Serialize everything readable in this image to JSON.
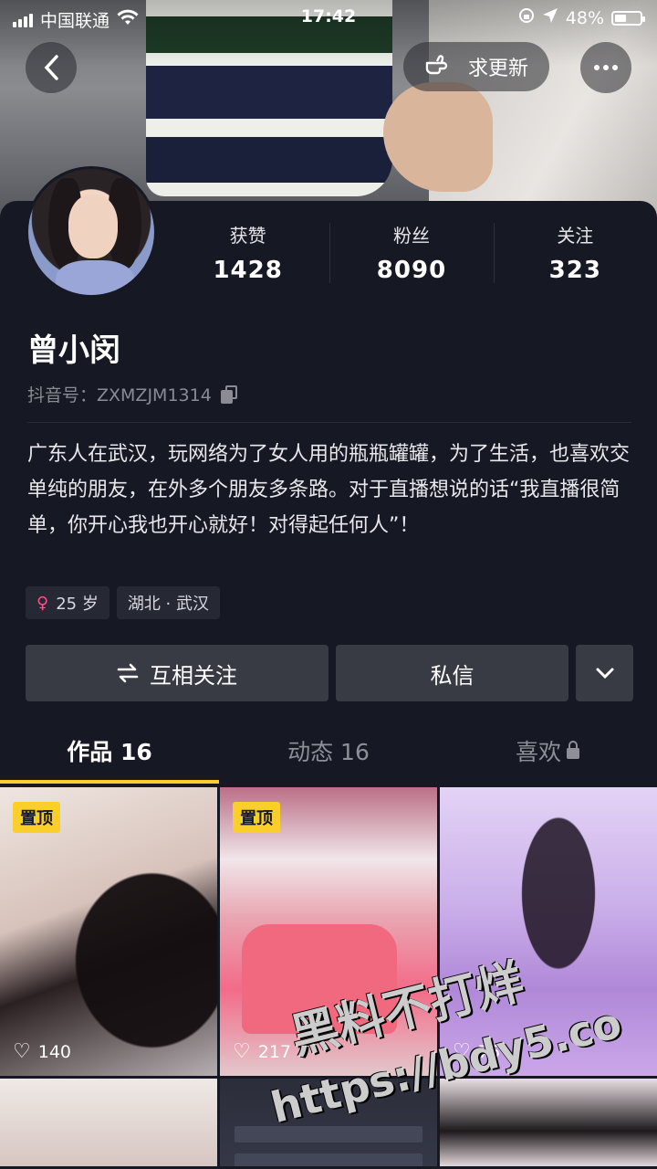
{
  "status_bar": {
    "carrier": "中国联通",
    "time": "17:42",
    "battery_text": "48%",
    "battery_level": 0.48
  },
  "top_bar": {
    "update_label": "求更新"
  },
  "profile": {
    "stats": [
      {
        "label": "获赞",
        "value": "1428"
      },
      {
        "label": "粉丝",
        "value": "8090"
      },
      {
        "label": "关注",
        "value": "323"
      }
    ],
    "name": "曾小闵",
    "douyin_id": "抖音号：ZXMZJM1314",
    "bio": "广东人在武汉，玩网络为了女人用的瓶瓶罐罐，为了生活，也喜欢交单纯的朋友，在外多个朋友多条路。对于直播想说的话“我直播很简单，你开心我也开心就好！对得起任何人”！",
    "tags": {
      "age": "25 岁",
      "location": "湖北 · 武汉"
    }
  },
  "actions": {
    "follow_label": "互相关注",
    "message_label": "私信"
  },
  "tabs": [
    {
      "label": "作品 16"
    },
    {
      "label": "动态 16"
    },
    {
      "label": "喜欢"
    }
  ],
  "videos": [
    {
      "pinned_label": "置顶",
      "likes": "140"
    },
    {
      "pinned_label": "置顶",
      "likes": "217"
    },
    {
      "likes": "76"
    }
  ],
  "watermark": {
    "line1": "黑料不打烊",
    "line2": "https://bdy5.co"
  },
  "colors": {
    "background": "#161823",
    "accent_yellow": "#facf2b",
    "button_gray": "#393b44",
    "female_pink": "#ff4f8a"
  }
}
